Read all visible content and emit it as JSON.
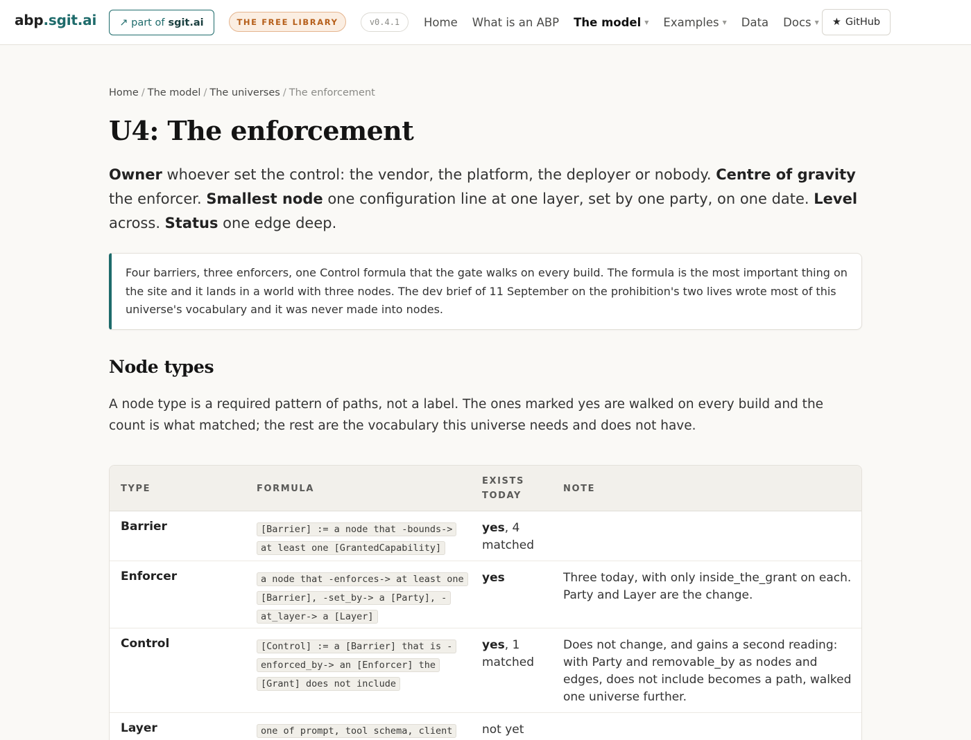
{
  "nav": {
    "brand_main": "abp",
    "brand_accent": ".sgit.ai",
    "partof_prefix": "↗ part of",
    "partof_site": "sgit.ai",
    "library_badge": "THE FREE LIBRARY",
    "version": "v0.4.1",
    "links": [
      {
        "label": "Home",
        "dropdown": false,
        "active": false
      },
      {
        "label": "What is an ABP",
        "dropdown": false,
        "active": false
      },
      {
        "label": "The model",
        "dropdown": true,
        "active": true
      },
      {
        "label": "Examples",
        "dropdown": true,
        "active": false
      },
      {
        "label": "Data",
        "dropdown": false,
        "active": false
      },
      {
        "label": "Docs",
        "dropdown": true,
        "active": false
      }
    ],
    "github_label": "GitHub",
    "github_icon": "★"
  },
  "breadcrumb": {
    "items": [
      "Home",
      "The model",
      "The universes"
    ],
    "current": "The enforcement"
  },
  "page": {
    "title": "U4: The enforcement",
    "lead": {
      "owner_k": "Owner",
      "owner_v": " whoever set the control: the vendor, the platform, the deployer or nobody. ",
      "centre_k": "Centre of gravity",
      "centre_v": " the enforcer. ",
      "smallest_k": "Smallest node",
      "smallest_v": " one configuration line at one layer, set by one party, on one date. ",
      "level_k": "Level",
      "level_v": " across. ",
      "status_k": "Status",
      "status_v": " one edge deep."
    },
    "callout": "Four barriers, three enforcers, one Control formula that the gate walks on every build. The formula is the most important thing on the site and it lands in a world with three nodes. The dev brief of 11 September on the prohibition's two lives wrote most of this universe's vocabulary and it was never made into nodes.",
    "section_title": "Node types",
    "section_intro": "A node type is a required pattern of paths, not a label. The ones marked yes are walked on every build and the count is what matched; the rest are the vocabulary this universe needs and does not have."
  },
  "table": {
    "headers": {
      "type": "TYPE",
      "formula": "FORMULA",
      "exists_1": "EXISTS",
      "exists_2": "TODAY",
      "note": "NOTE"
    },
    "rows": [
      {
        "type": "Barrier",
        "formula": "[Barrier] := a node that -bounds-> at least one [GrantedCapability]",
        "exists_strong": "yes",
        "exists_rest": ", 4 matched",
        "note": ""
      },
      {
        "type": "Enforcer",
        "formula": "a node that -enforces-> at least one [Barrier], -set_by-> a [Party], -at_layer-> a [Layer]",
        "exists_strong": "yes",
        "exists_rest": "",
        "note": "Three today, with only inside_the_grant on each. Party and Layer are the change."
      },
      {
        "type": "Control",
        "formula": "[Control] := a [Barrier] that is -enforced_by-> an [Enforcer] the [Grant] does not include",
        "exists_strong": "yes",
        "exists_rest": ", 1 matched",
        "note": "Does not change, and gains a second reading: with Party and removable_by as nodes and edges, does not include becomes a path, walked one universe further."
      },
      {
        "type": "Layer",
        "formula": "one of prompt, tool schema, client",
        "exists_strong": "",
        "exists_rest": "not yet",
        "note": ""
      }
    ]
  }
}
